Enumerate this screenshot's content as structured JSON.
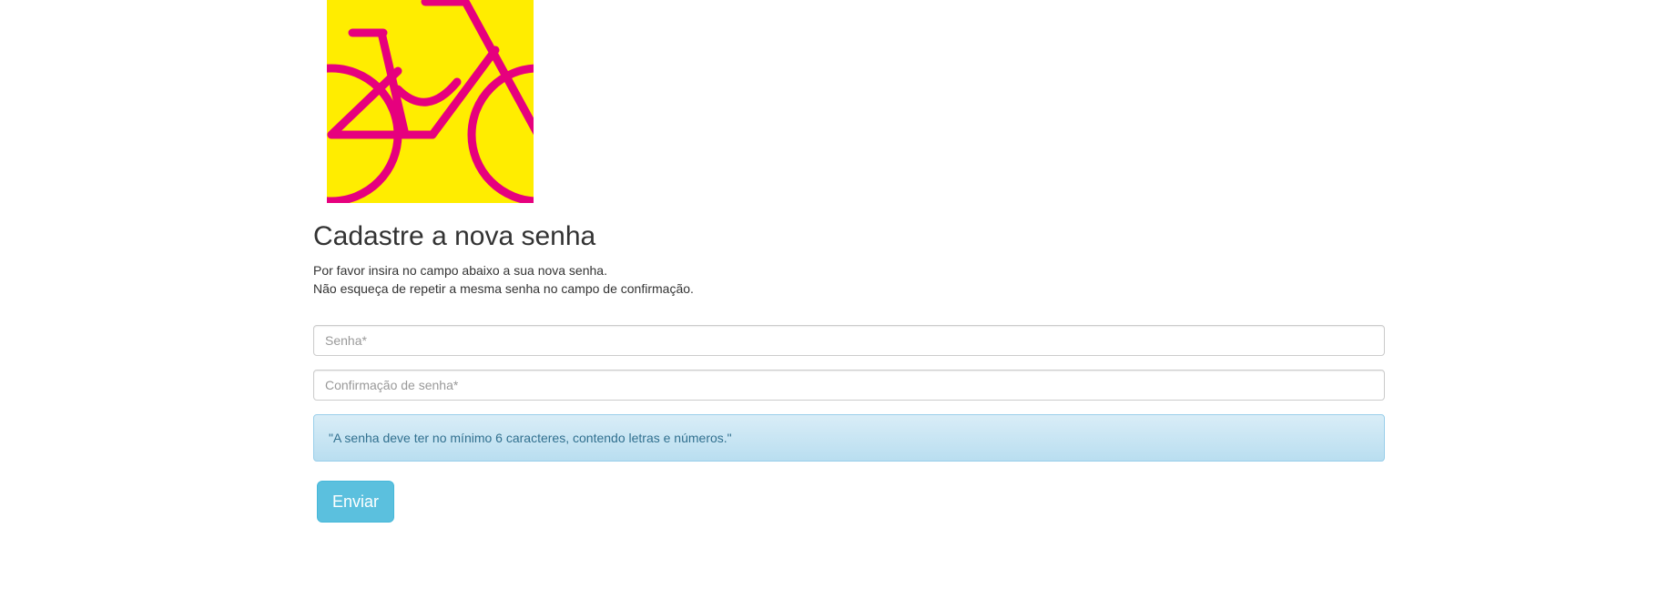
{
  "logo": {
    "icon": "bicycle-icon",
    "background_color": "#ffed00",
    "foreground_color": "#e6007e"
  },
  "page": {
    "title": "Cadastre a nova senha",
    "description_line1": "Por favor insira no campo abaixo a sua nova senha.",
    "description_line2": "Não esqueça de repetir a mesma senha no campo de confirmação."
  },
  "form": {
    "password_placeholder": "Senha*",
    "password_value": "",
    "confirm_placeholder": "Confirmação de senha*",
    "confirm_value": "",
    "info_message": "\"A senha deve ter no mínimo 6 caracteres, contendo letras e números.\"",
    "submit_label": "Enviar"
  }
}
